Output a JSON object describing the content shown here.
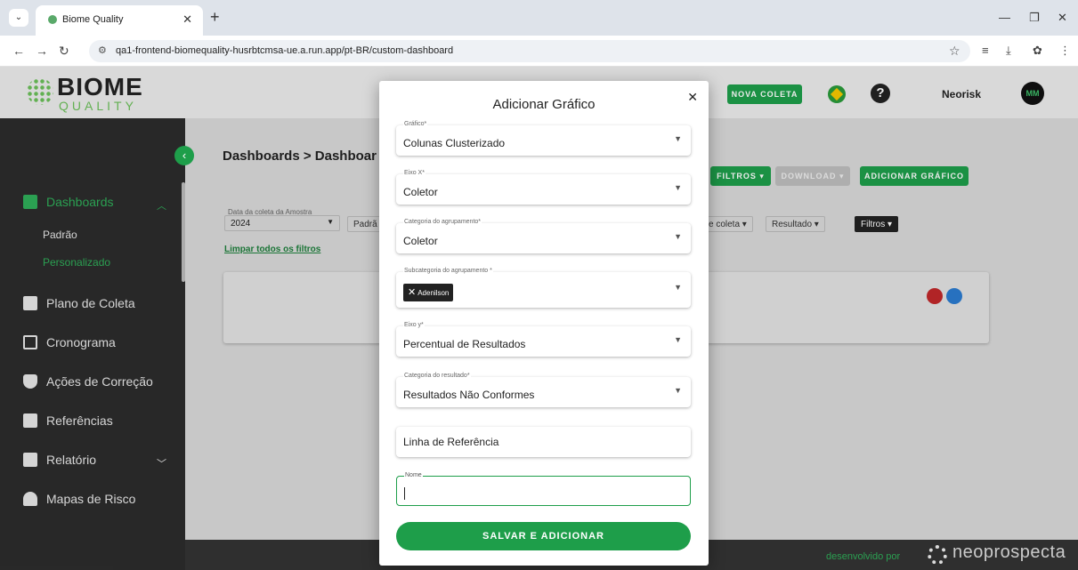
{
  "browser": {
    "tab_title": "Biome Quality",
    "url": "qa1-frontend-biomequality-husrbtcmsa-ue.a.run.app/pt-BR/custom-dashboard"
  },
  "header": {
    "logo_main": "BIOME",
    "logo_sub": "QUALITY",
    "nova_coleta": "NOVA COLETA",
    "help": "?",
    "user_name": "Neorisk",
    "avatar_initials": "MM"
  },
  "sidebar": {
    "items": [
      {
        "label": "Dashboards"
      },
      {
        "label": "Padrão"
      },
      {
        "label": "Personalizado"
      },
      {
        "label": "Plano de Coleta"
      },
      {
        "label": "Cronograma"
      },
      {
        "label": "Ações de Correção"
      },
      {
        "label": "Referências"
      },
      {
        "label": "Relatório"
      },
      {
        "label": "Mapas de Risco"
      }
    ]
  },
  "content": {
    "breadcrumb": "Dashboards > Dashboar",
    "buttons": {
      "filtros": "FILTROS ▾",
      "download": "DOWNLOAD ▾",
      "adicionar": "ADICIONAR GRÁFICO"
    },
    "filter_label": "Data da coleta da Amostra",
    "filter_value": "2024",
    "chip_padrao": "Padrã",
    "chip_coleta": "e coleta ▾",
    "chip_resultado": "Resultado ▾",
    "chip_filtros": "Filtros ▾",
    "limpar": "Limpar todos os filtros"
  },
  "footer": {
    "dev_by": "desenvolvido por",
    "brand": "neoprospecta"
  },
  "modal": {
    "title": "Adicionar Gráfico",
    "fields": [
      {
        "label": "Gráfico*",
        "value": "Colunas Clusterizado"
      },
      {
        "label": "Eixo X*",
        "value": "Coletor"
      },
      {
        "label": "Categoria do agrupamento*",
        "value": "Coletor"
      },
      {
        "label": "Subcategoria do agrupamento *",
        "tag": "Adenilson"
      },
      {
        "label": "Eixo y*",
        "value": "Percentual de Resultados"
      },
      {
        "label": "Categoria do resultado*",
        "value": "Resultados Não Conformes"
      },
      {
        "placeholder": "Linha de Referência"
      },
      {
        "label": "Nome",
        "value": ""
      }
    ],
    "submit": "SALVAR E ADICIONAR"
  }
}
